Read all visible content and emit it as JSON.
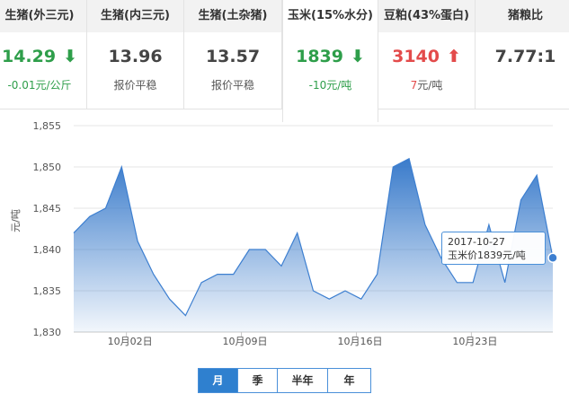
{
  "cards": [
    {
      "title": "生猪(外三元)",
      "value": "14.29",
      "arrow": "down",
      "arrow_glyph": "⬇",
      "sub": "-0.01元/公斤",
      "value_color": "#2e9e4a",
      "sub_color": "#2e9e4a"
    },
    {
      "title": "生猪(内三元)",
      "value": "13.96",
      "arrow": "",
      "arrow_glyph": "",
      "sub": "报价平稳",
      "value_color": "#444444",
      "sub_color": "#555555"
    },
    {
      "title": "生猪(土杂猪)",
      "value": "13.57",
      "arrow": "",
      "arrow_glyph": "",
      "sub": "报价平稳",
      "value_color": "#444444",
      "sub_color": "#555555"
    },
    {
      "title": "玉米(15%水分)",
      "value": "1839",
      "arrow": "down",
      "arrow_glyph": "⬇",
      "sub": "-10元/吨",
      "value_color": "#2e9e4a",
      "sub_color": "#2e9e4a",
      "active": true
    },
    {
      "title": "豆粕(43%蛋白)",
      "value": "3140",
      "arrow": "up",
      "arrow_glyph": "⬆",
      "sub_colored": "7",
      "sub_rest": "元/吨",
      "value_color": "#e34b4b",
      "sub_color": "#e34b4b"
    },
    {
      "title": "猪粮比",
      "value": "7.77:1",
      "arrow": "",
      "arrow_glyph": "",
      "sub": "",
      "value_color": "#444444",
      "sub_color": "#555555"
    }
  ],
  "tooltip": {
    "date": "2017-10-27",
    "text": "玉米价1839元/吨"
  },
  "buttons": [
    {
      "label": "月",
      "active": true
    },
    {
      "label": "季",
      "active": false
    },
    {
      "label": "半年",
      "active": false
    },
    {
      "label": "年",
      "active": false
    }
  ],
  "chart_data": {
    "type": "area",
    "ylabel": "元/吨",
    "ylim": [
      1830,
      1855
    ],
    "yticks": [
      "1,830",
      "1,835",
      "1,840",
      "1,845",
      "1,850",
      "1,855"
    ],
    "xticks": [
      "10月02日",
      "10月09日",
      "10月16日",
      "10月23日"
    ],
    "grid": true,
    "series": [
      {
        "values": [
          1842,
          1844,
          1845,
          1850,
          1841,
          1837,
          1834,
          1832,
          1836,
          1837,
          1837,
          1840,
          1840,
          1838,
          1842,
          1835,
          1834,
          1835,
          1834,
          1837,
          1850,
          1851,
          1843,
          1839,
          1836,
          1836,
          1843,
          1836,
          1846,
          1849,
          1839
        ]
      }
    ],
    "color": "#3d7fd0"
  }
}
